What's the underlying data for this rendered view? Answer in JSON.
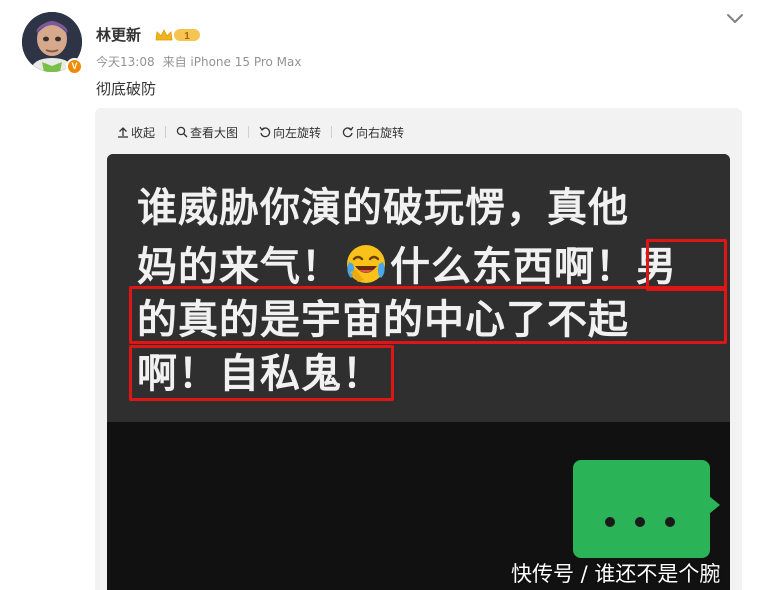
{
  "post": {
    "author": "林更新",
    "member_level": "1",
    "timestamp": "今天13:08",
    "source": "来自 iPhone 15 Pro Max",
    "text": "彻底破防"
  },
  "toolbar": {
    "collapse": "收起",
    "view_large": "查看大图",
    "rotate_left": "向左旋转",
    "rotate_right": "向右旋转"
  },
  "image": {
    "line1": "谁威胁你演的破玩愣，真他",
    "line2_a": "妈的来气！",
    "line2_b": "什么东西啊！",
    "line2_c": "男",
    "line3": "的真的是宇宙的中心了不起",
    "line4": "啊！自私鬼！",
    "emoji": "crying-laughing-emoji",
    "watermark": "快传号 / 谁还不是个腕"
  },
  "colors": {
    "highlight_box": "#e01515",
    "chat_green": "#2bb457",
    "verify_orange": "#f08a00"
  }
}
